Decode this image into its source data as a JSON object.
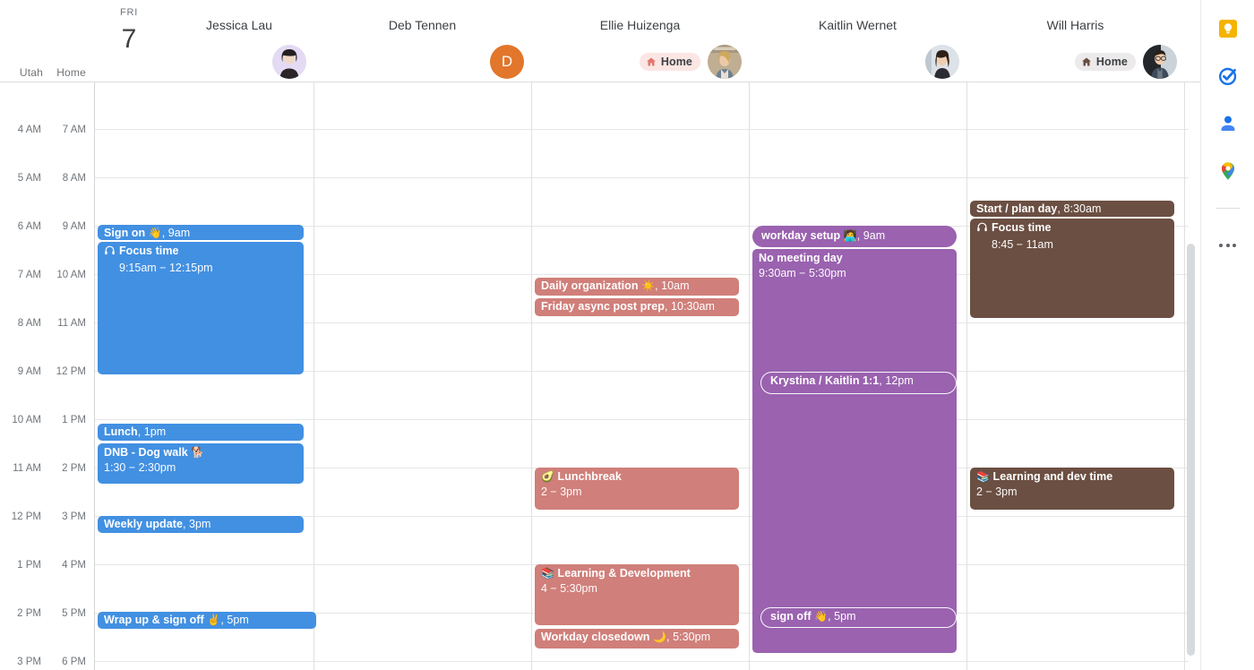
{
  "app": {
    "view": "day",
    "date": {
      "weekday": "FRI",
      "day": "7"
    },
    "timezones": {
      "left_label": "Utah",
      "right_label": "Home"
    },
    "time_rows": [
      {
        "left": "4 AM",
        "right": "7 AM"
      },
      {
        "left": "5 AM",
        "right": "8 AM"
      },
      {
        "left": "6 AM",
        "right": "9 AM"
      },
      {
        "left": "7 AM",
        "right": "10 AM"
      },
      {
        "left": "8 AM",
        "right": "11 AM"
      },
      {
        "left": "9 AM",
        "right": "12 PM"
      },
      {
        "left": "10 AM",
        "right": "1 PM"
      },
      {
        "left": "11 AM",
        "right": "2 PM"
      },
      {
        "left": "12 PM",
        "right": "3 PM"
      },
      {
        "left": "1 PM",
        "right": "4 PM"
      },
      {
        "left": "2 PM",
        "right": "5 PM"
      },
      {
        "left": "3 PM",
        "right": "6 PM"
      }
    ]
  },
  "colors": {
    "blue": "#4290E2",
    "salmon": "#D07F7A",
    "purple": "#9A62AF",
    "brown": "#6B4F42",
    "orange_avatar": "#E2762B",
    "badge_pink": "#FBE6E4",
    "badge_gray": "#ECEAEA",
    "grid_line": "#E6E6E6"
  },
  "people": [
    {
      "name": "Jessica Lau",
      "avatar_type": "photo",
      "avatar_bg": "#E4DAF3",
      "badge": null,
      "color": "#4290E2",
      "events": [
        {
          "title": "Sign on",
          "emoji": "👋",
          "time": "9am",
          "style": "chip"
        },
        {
          "title": "Focus time",
          "icon": "headphones-icon",
          "time": "9:15am − 12:15pm",
          "style": "block"
        },
        {
          "title": "Lunch",
          "time": "1pm",
          "style": "chip"
        },
        {
          "title": "DNB - Dog walk",
          "emoji": "🐕",
          "time": "1:30 − 2:30pm",
          "style": "block"
        },
        {
          "title": "Weekly update",
          "time": "3pm",
          "style": "chip"
        },
        {
          "title": "Wrap up & sign off",
          "emoji": "✌️",
          "time": "5pm",
          "style": "chip"
        }
      ]
    },
    {
      "name": "Deb Tennen",
      "avatar_type": "initial",
      "avatar_initial": "D",
      "avatar_bg": "#E2762B",
      "badge": null,
      "color": null,
      "events": []
    },
    {
      "name": "Ellie Huizenga",
      "avatar_type": "photo",
      "avatar_bg": "#C8B89A",
      "badge": {
        "label": "Home",
        "icon": "home-icon",
        "tone": "pink"
      },
      "color": "#D07F7A",
      "events": [
        {
          "title": "Daily organization",
          "emoji": "☀️",
          "time": "10am",
          "style": "chip"
        },
        {
          "title": "Friday async post prep",
          "time": "10:30am",
          "style": "chip"
        },
        {
          "title": "Lunchbreak",
          "emoji": "🥑",
          "time": "2 − 3pm",
          "style": "block"
        },
        {
          "title": "Learning & Development",
          "emoji": "📚",
          "time": "4 − 5:30pm",
          "style": "block"
        },
        {
          "title": "Workday closedown",
          "emoji": "🌙",
          "time": "5:30pm",
          "style": "chip"
        }
      ]
    },
    {
      "name": "Kaitlin Wernet",
      "avatar_type": "photo",
      "avatar_bg": "#D8DEE4",
      "badge": null,
      "color": "#9A62AF",
      "events": [
        {
          "title": "workday setup",
          "emoji": "🧑‍💻",
          "time": "9am",
          "style": "chip-outline"
        },
        {
          "title": "No meeting day",
          "time": "9:30am − 5:30pm",
          "style": "block"
        },
        {
          "title": "Krystina / Kaitlin 1:1",
          "time": "12pm",
          "style": "outline"
        },
        {
          "title": "sign off",
          "emoji": "👋",
          "time": "5pm",
          "style": "outline"
        }
      ]
    },
    {
      "name": "Will Harris",
      "avatar_type": "photo",
      "avatar_bg": "#C3CBD4",
      "badge": {
        "label": "Home",
        "icon": "home-icon",
        "tone": "gray"
      },
      "color": "#6B4F42",
      "events": [
        {
          "title": "Start / plan day",
          "time": "8:30am",
          "style": "chip"
        },
        {
          "title": "Focus time",
          "icon": "headphones-icon",
          "time": "8:45 − 11am",
          "style": "block"
        },
        {
          "title": "Learning and dev time",
          "emoji": "📚",
          "time": "2 − 3pm",
          "style": "block"
        }
      ]
    }
  ],
  "side_rail": {
    "items": [
      {
        "name": "google-keep-icon",
        "label": "Keep"
      },
      {
        "name": "google-tasks-icon",
        "label": "Tasks"
      },
      {
        "name": "google-contacts-icon",
        "label": "Contacts"
      },
      {
        "name": "google-maps-icon",
        "label": "Maps"
      },
      {
        "name": "more-options-icon",
        "label": "More"
      }
    ]
  }
}
